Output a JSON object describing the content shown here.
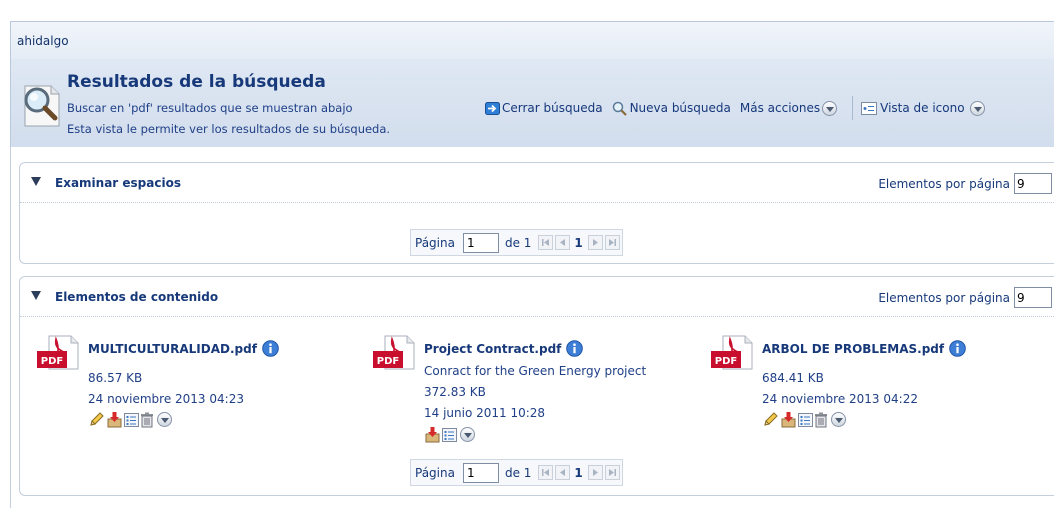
{
  "user": {
    "name": "ahidalgo"
  },
  "header": {
    "title": "Resultados de la búsqueda",
    "subtitle": "Buscar en 'pdf' resultados que se muestran abajo",
    "description": "Esta vista le permite ver los resultados de su búsqueda.",
    "actions": {
      "close_search": "Cerrar búsqueda",
      "new_search": "Nueva búsqueda",
      "more_actions": "Más acciones",
      "icon_view": "Vista de icono"
    }
  },
  "spaces_panel": {
    "title": "Examinar espacios",
    "per_page_label": "Elementos por página",
    "per_page_value": "9",
    "pager": {
      "page_label": "Página",
      "page_value": "1",
      "of_label": "de 1",
      "current": "1"
    }
  },
  "content_panel": {
    "title": "Elementos de contenido",
    "per_page_label": "Elementos por página",
    "per_page_value": "9",
    "items": [
      {
        "name": "MULTICULTURALIDAD.pdf",
        "description": "",
        "size": "86.57 KB",
        "date": "24 noviembre 2013 04:23"
      },
      {
        "name": "Project Contract.pdf",
        "description": "Conract for the Green Energy project",
        "size": "372.83 KB",
        "date": "14 junio 2011 10:28"
      },
      {
        "name": "ARBOL DE PROBLEMAS.pdf",
        "description": "",
        "size": "684.41 KB",
        "date": "24 noviembre 2013 04:22"
      }
    ],
    "pager": {
      "page_label": "Página",
      "page_value": "1",
      "of_label": "de 1",
      "current": "1"
    }
  },
  "icons": {
    "search": "magnifier-icon",
    "pdf": "pdf-file-icon",
    "info": "info-icon",
    "edit": "pencil-icon",
    "download": "download-icon",
    "details": "details-list-icon",
    "delete": "trash-icon",
    "more": "chevron-down-circle-icon"
  },
  "colors": {
    "link": "#17397a",
    "header_bg": "#d9e3f0",
    "pdf_red": "#c8102e"
  }
}
